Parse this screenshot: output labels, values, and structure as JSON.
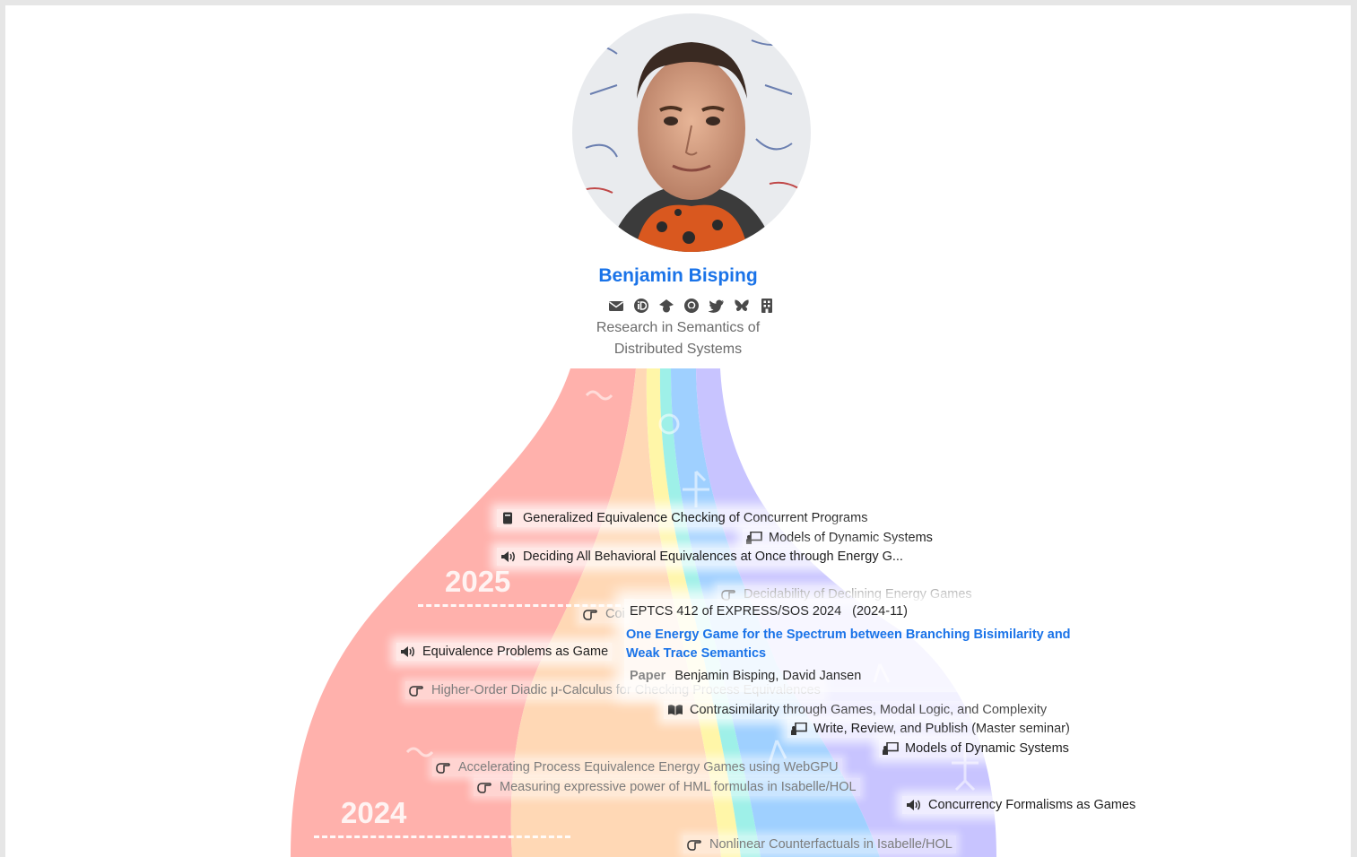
{
  "profile": {
    "name": "Benjamin Bisping",
    "tagline_line1": "Research in Semantics of",
    "tagline_line2": "Distributed Systems",
    "links": [
      "envelope-icon",
      "orcid-icon",
      "scholar-icon",
      "github-icon",
      "twitter-icon",
      "bluesky-icon",
      "institution-icon"
    ]
  },
  "timeline": {
    "years": [
      "2025",
      "2024"
    ],
    "stream_colors": [
      "#ffb1ac",
      "#ffd8b5",
      "#fff6a8",
      "#9ef0e8",
      "#9fd0ff",
      "#c8c4ff"
    ],
    "entries": [
      {
        "icon": "book-icon",
        "text": "Generalized Equivalence Checking of Concurrent Programs",
        "faint": false
      },
      {
        "icon": "teaching-icon",
        "text": "Models of Dynamic Systems",
        "faint": false
      },
      {
        "icon": "talk-icon",
        "text": "Deciding All Behavioral Equivalences at Once through Energy G...",
        "faint": false
      },
      {
        "icon": "thesis-icon",
        "text": "Decidability of Declining Energy Games",
        "faint": true
      },
      {
        "icon": "thesis-icon",
        "text": "Coi",
        "faint": true
      },
      {
        "icon": "talk-icon",
        "text": "Equivalence Problems as Game",
        "faint": false
      },
      {
        "icon": "thesis-icon",
        "text": "Higher-Order Diadic μ-Calculus for Checking Process Equivalences",
        "faint": true
      },
      {
        "icon": "open-book-icon",
        "text": "Contrasimilarity through Games, Modal Logic, and Complexity",
        "faint": false
      },
      {
        "icon": "teaching-icon",
        "text": "Write, Review, and Publish (Master seminar)",
        "faint": false
      },
      {
        "icon": "teaching-icon",
        "text": "Models of Dynamic Systems",
        "faint": false
      },
      {
        "icon": "thesis-icon",
        "text": "Accelerating Process Equivalence Energy Games using WebGPU",
        "faint": true
      },
      {
        "icon": "thesis-icon",
        "text": "Measuring expressive power of HML formulas in Isabelle/HOL",
        "faint": true
      },
      {
        "icon": "talk-icon",
        "text": "Concurrency Formalisms as Games",
        "faint": false
      },
      {
        "icon": "thesis-icon",
        "text": "Nonlinear Counterfactuals in Isabelle/HOL",
        "faint": true
      }
    ]
  },
  "popup": {
    "venue": "EPTCS 412 of EXPRESS/SOS 2024",
    "date": "(2024-11)",
    "title": "One Energy Game for the Spectrum between Branching Bisimilarity and Weak Trace Semantics",
    "kind": "Paper",
    "authors": "Benjamin Bisping, David Jansen"
  }
}
